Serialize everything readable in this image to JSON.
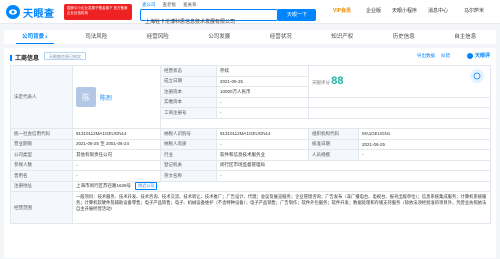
{
  "header": {
    "logo_text": "天眼查",
    "notice": "国家中小企业发展子基金旗下 官方备案企业征信机构",
    "search_tabs": [
      "查公司",
      "查老板",
      "查关系"
    ],
    "search_value": "上海铨卡伦博科思信息技术发展有限公司",
    "search_button": "天眼一下",
    "vip": "VIP会员",
    "links": [
      "企业版",
      "天眼小程序",
      "消息中心",
      "马尔萨米"
    ]
  },
  "tabs": [
    {
      "label": "公司背景",
      "count": "3"
    },
    {
      "label": "司法风险",
      "count": ""
    },
    {
      "label": "经营风险",
      "count": ""
    },
    {
      "label": "公司发展",
      "count": ""
    },
    {
      "label": "经营状况",
      "count": ""
    },
    {
      "label": "知识产权",
      "count": ""
    },
    {
      "label": "历史信息",
      "count": ""
    },
    {
      "label": "自主信息",
      "count": ""
    }
  ],
  "card": {
    "title": "工商信息",
    "badge": "天眼查信息已核实",
    "tools": [
      "导出数据",
      "纠错"
    ],
    "brand": "天眼评"
  },
  "info": {
    "legal_rep_label": "法定代表人",
    "legal_avatar": "陈",
    "legal_name": "陈烈",
    "status_label": "经营状态",
    "status_value": "存续",
    "found_label": "成立日期",
    "found_value": "2021-06-25",
    "score_label": "天眼评分",
    "score_value": "88",
    "capital_label": "注册资本",
    "capital_value": "10000万人民币",
    "paid_label": "实缴资本",
    "paid_value": "-",
    "reg_no_label": "工商注册号",
    "reg_no_value": "-",
    "credit_label": "统一社会信用代码",
    "credit_value": "91310112MA1GEUGN14",
    "tax_label": "纳税人识别号",
    "tax_value": "91310112MA1GEUGN14",
    "org_label": "组织机构代码",
    "org_value": "MA1GEUGN1",
    "term_label": "营业期限",
    "term_value": "2021-06-25 至 2051-06-24",
    "taxpayer_label": "纳税人资质",
    "taxpayer_value": "-",
    "approve_label": "核准日期",
    "approve_value": "2021-06-25",
    "type_label": "公司类型",
    "type_value": "其他有限责任公司",
    "industry_label": "行业",
    "industry_value": "软件和信息技术服务业",
    "staff_label": "人员规模",
    "staff_value": "-",
    "insured_label": "参保人数",
    "insured_value": "-",
    "authority_label": "登记机关",
    "authority_value": "闵行区市场监督管理局",
    "used_name_label": "曾用名",
    "used_name_value": "-",
    "en_name_label": "英文名称",
    "en_name_value": "-",
    "address_label": "注册地址",
    "address_value": "上海市闵行区苏召路1628号",
    "address_link": "附近公司",
    "scope_label": "经营范围",
    "scope_value": "一般项目：技术服务、技术开发、技术咨询、技术交流、技术转让、技术推广；广告设计、代理；会议及展览服务；企业管理咨询；广告发布（非广播电台、电视台、报刊出版单位）；信息系统集成服务；计算机系统服务；计算机软硬件及辅助设备零售；电子产品销售；电子、机械设备维护（不含特种设备）；电子产品销售；广告制作；软件外包服务；软件开发；数据处理和存储支持服务（除依法须经批准的项目外，凭营业执照依法自主开展经营活动）"
  },
  "colors": {
    "accent": "#0084ff",
    "score": "#1fb3a6"
  }
}
